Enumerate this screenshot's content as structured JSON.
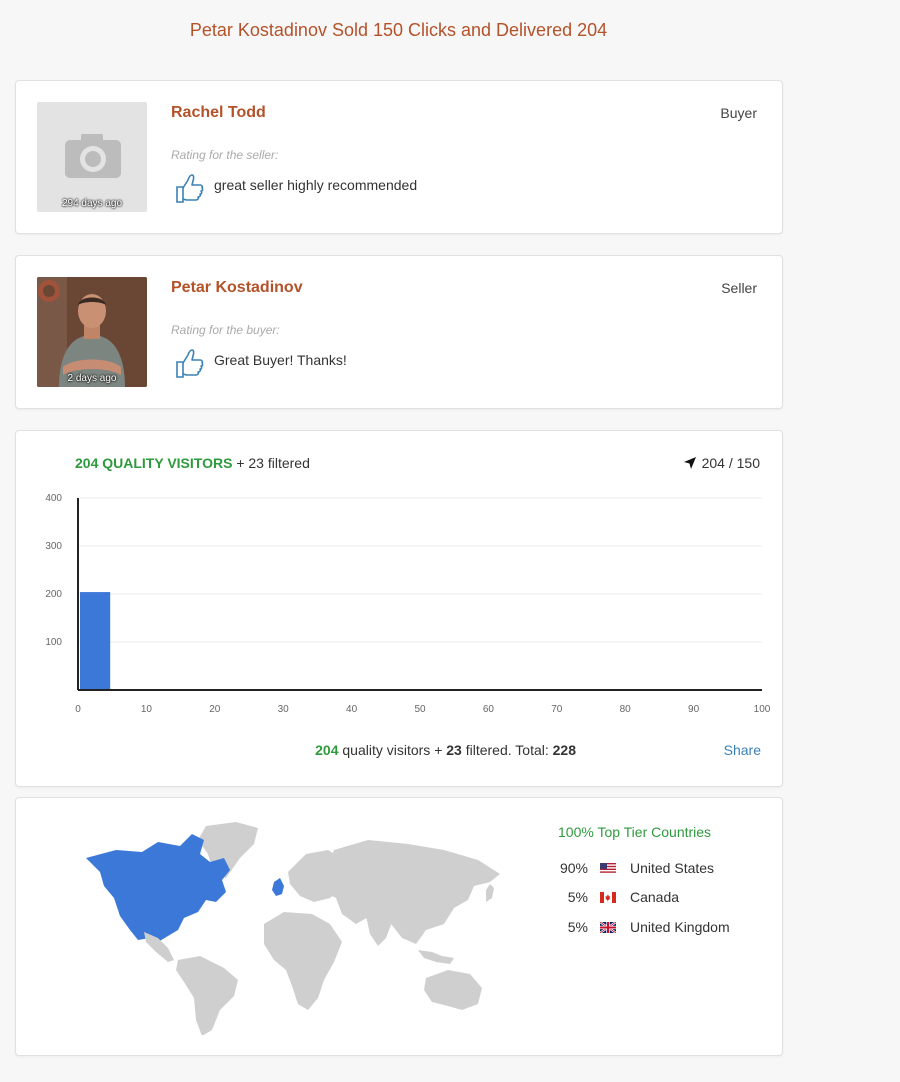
{
  "header": {
    "title": "Petar Kostadinov Sold 150 Clicks and Delivered 204"
  },
  "reviews": [
    {
      "name": "Rachel Todd",
      "role": "Buyer",
      "time_ago": "294 days ago",
      "rating_label": "Rating for the seller:",
      "text": "great seller highly recommended"
    },
    {
      "name": "Petar Kostadinov",
      "role": "Seller",
      "time_ago": "2 days ago",
      "rating_label": "Rating for the buyer:",
      "text": "Great Buyer! Thanks!"
    }
  ],
  "stats": {
    "quality_visitors_label": "204 QUALITY VISITORS",
    "filtered_label": "+ 23 filtered",
    "ratio": "204 / 150",
    "footer": {
      "quality_count": "204",
      "quality_text": "quality visitors +",
      "filtered_count": "23",
      "filtered_text": "filtered. Total:",
      "total": "228"
    },
    "share_label": "Share"
  },
  "chart_data": {
    "type": "bar",
    "x": [
      2.5
    ],
    "values": [
      204
    ],
    "bar_width": 5,
    "xlim": [
      0,
      100
    ],
    "ylim": [
      0,
      400
    ],
    "xticks": [
      0,
      10,
      20,
      30,
      40,
      50,
      60,
      70,
      80,
      90,
      100
    ],
    "yticks": [
      100,
      200,
      300,
      400
    ],
    "grid": true,
    "bar_color": "#3b78d8"
  },
  "countries": {
    "title": "100% Top Tier Countries",
    "items": [
      {
        "pct": "90%",
        "name": "United States",
        "flag": "us-flag-icon"
      },
      {
        "pct": "5%",
        "name": "Canada",
        "flag": "ca-flag-icon"
      },
      {
        "pct": "5%",
        "name": "United Kingdom",
        "flag": "gb-flag-icon"
      }
    ],
    "highlight_color": "#3b78d8",
    "land_color": "#cfcfcf"
  }
}
